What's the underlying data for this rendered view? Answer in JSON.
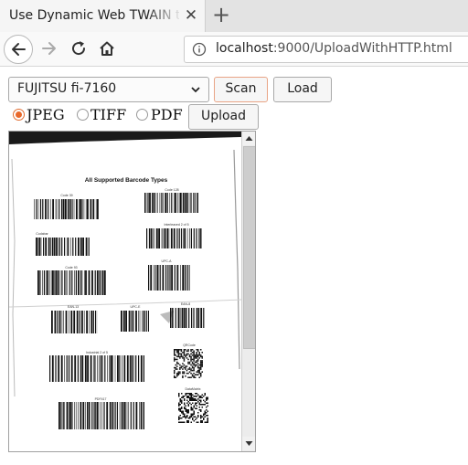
{
  "browser": {
    "tab_title": "Use Dynamic Web TWAIN to",
    "tab_close": "✕",
    "new_tab": "+",
    "url_host": "localhost",
    "url_rest": ":9000/UploadWithHTTP.html"
  },
  "toolbar": {
    "scanner_selected": "FUJITSU fi-7160",
    "scan_label": "Scan",
    "load_label": "Load",
    "upload_label": "Upload"
  },
  "formats": [
    {
      "label": "JPEG",
      "checked": true
    },
    {
      "label": "TIFF",
      "checked": false
    },
    {
      "label": "PDF",
      "checked": false
    }
  ],
  "scan": {
    "title": "All Supported Barcode Types",
    "labels": {
      "code39": "Code 39",
      "code128": "Code 128",
      "codabar": "Codabar",
      "interleaved": "Interleaved 2 of 5",
      "code93": "Code 93",
      "upca": "UPC-A",
      "ean13": "EAN-13",
      "upce": "UPC-E",
      "ean8": "EAN-8",
      "industrial": "Industrial 2 of 5",
      "qrcode": "QRCode",
      "pdf417": "PDF417",
      "datamatrix": "DataMatrix"
    }
  }
}
